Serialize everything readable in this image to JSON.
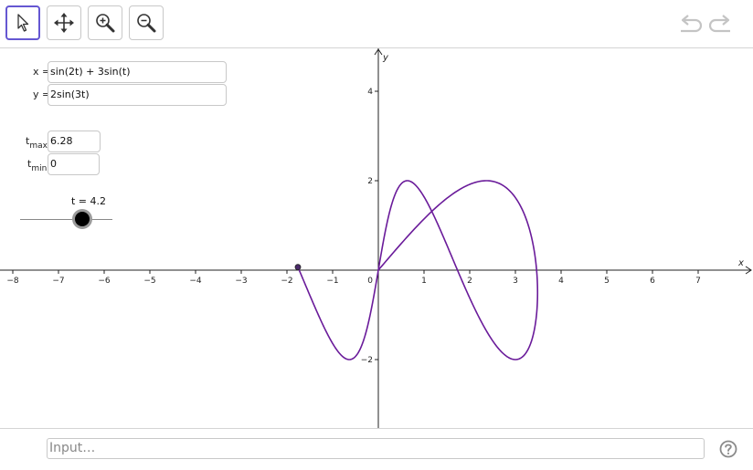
{
  "toolbar": {
    "tools": [
      {
        "name": "move-tool",
        "icon": "arrow-pointer-icon",
        "selected": true
      },
      {
        "name": "move-graphics-view-tool",
        "icon": "move-arrows-icon",
        "selected": false
      },
      {
        "name": "zoom-in-tool",
        "icon": "zoom-in-icon",
        "selected": false
      },
      {
        "name": "zoom-out-tool",
        "icon": "zoom-out-icon",
        "selected": false
      }
    ],
    "undo_icon": "undo-icon",
    "redo_icon": "redo-icon",
    "selected_color": "#6557d2"
  },
  "equations": {
    "x_label": "x =",
    "x_value": "sin(2t) + 3sin(t)",
    "y_label": "y =",
    "y_value": "2sin(3t)"
  },
  "params": {
    "tmax_main": "t",
    "tmax_sub": "max",
    "tmax_value": "6.28",
    "tmin_main": "t",
    "tmin_sub": "min",
    "tmin_value": "0"
  },
  "slider": {
    "label": "t = 4.2",
    "value": 4.2,
    "min": 0,
    "max": 6.28
  },
  "graph": {
    "x_axis_label": "x",
    "y_axis_label": "y",
    "x_ticks": [
      "−8",
      "−7",
      "−6",
      "−5",
      "−4",
      "−3",
      "−2",
      "−1",
      "0",
      "1",
      "2",
      "3",
      "4",
      "5",
      "6",
      "7"
    ],
    "y_ticks": [
      "4",
      "2",
      "−2"
    ],
    "curve_color": "#6a1b9a",
    "point_color": "#4b2a6b",
    "x_range": [
      -8.3,
      8.2
    ],
    "y_range": [
      -3.5,
      4.9
    ]
  },
  "input_bar": {
    "placeholder": "Input…",
    "help_icon": "help-icon"
  }
}
